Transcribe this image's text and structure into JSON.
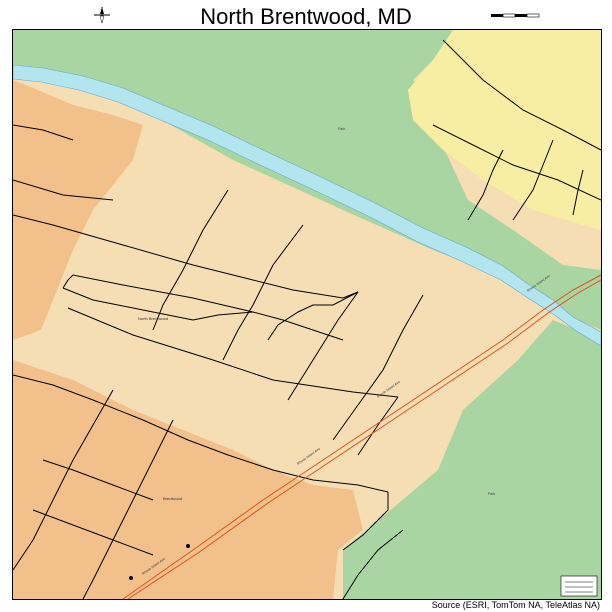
{
  "title": "North Brentwood, MD",
  "source": "Source (ESRI, TomTom NA, TeleAtlas NA)",
  "colors": {
    "residential": "#f5deb3",
    "commercial": "#f2c08a",
    "park": "#a8d5a2",
    "yellow_zone": "#f7eea3",
    "water": "#b3e5ef",
    "road": "#000000",
    "highway": "#e0501a"
  },
  "labels": {
    "place_north_brentwood": "North Brentwood",
    "place_brentwood": "Brentwood",
    "park_label": "Park",
    "park_label_2": "Park",
    "street_1": "Rhode Island Ave",
    "street_2": "Rhode Island Ave",
    "street_3": "Rhode Island Ave",
    "street_4": "Rhode Island Ave"
  },
  "icons": {
    "north_arrow": "compass-icon",
    "scale": "scale-bar-icon"
  }
}
